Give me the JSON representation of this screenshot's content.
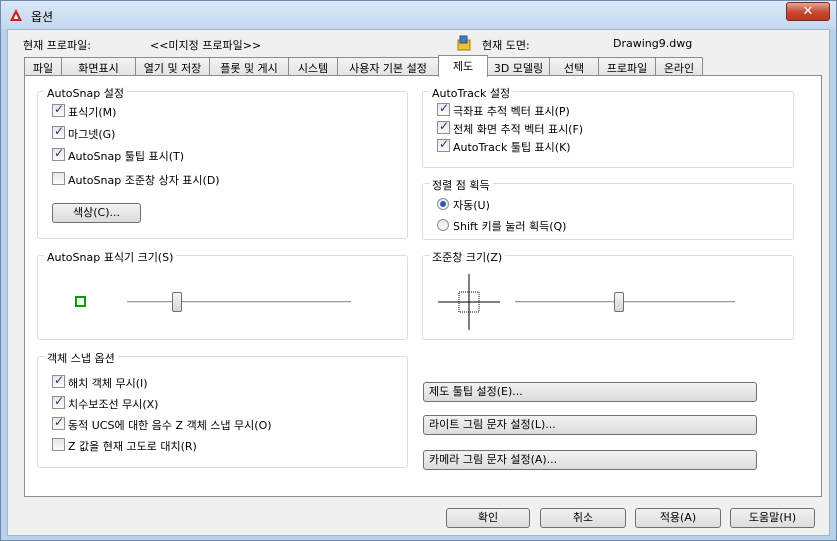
{
  "window": {
    "title": "옵션",
    "close_symbol": "✕"
  },
  "header": {
    "profile_label": "현재 프로파일:",
    "profile_value": "<<미지정 프로파일>>",
    "drawing_label": "현재 도면:",
    "drawing_value": "Drawing9.dwg"
  },
  "tabs": [
    {
      "label": "파일"
    },
    {
      "label": "화면표시"
    },
    {
      "label": "열기 및 저장"
    },
    {
      "label": "플롯 및 게시"
    },
    {
      "label": "시스템"
    },
    {
      "label": "사용자 기본 설정"
    },
    {
      "label": "제도"
    },
    {
      "label": "3D 모델링"
    },
    {
      "label": "선택"
    },
    {
      "label": "프로파일"
    },
    {
      "label": "온라인"
    }
  ],
  "active_tab": "제도",
  "autosnap": {
    "title": "AutoSnap 설정",
    "options": [
      {
        "label": "표식기(M)",
        "checked": true
      },
      {
        "label": "마그넷(G)",
        "checked": true
      },
      {
        "label": "AutoSnap 툴팁 표시(T)",
        "checked": true
      },
      {
        "label": "AutoSnap 조준창 상자 표시(D)",
        "checked": false
      }
    ],
    "color_button": "색상(C)..."
  },
  "autotrack": {
    "title": "AutoTrack 설정",
    "options": [
      {
        "label": "극좌표 추적 벡터 표시(P)",
        "checked": true
      },
      {
        "label": "전체 화면 추적 벡터 표시(F)",
        "checked": true
      },
      {
        "label": "AutoTrack 툴팁 표시(K)",
        "checked": true
      }
    ]
  },
  "alignment": {
    "title": "정렬 점 획득",
    "options": [
      {
        "label": "자동(U)",
        "selected": true
      },
      {
        "label": "Shift 키를 눌러 획득(Q)",
        "selected": false
      }
    ]
  },
  "marker_size": {
    "title": "AutoSnap 표식기 크기(S)",
    "slider_level": 0.22,
    "marker_color": "#0a9a0a"
  },
  "aperture_size": {
    "title": "조준창 크기(Z)",
    "slider_level": 0.47
  },
  "object_snap": {
    "title": "객체 스냅 옵션",
    "options": [
      {
        "label": "해치 객체 무시(I)",
        "checked": true
      },
      {
        "label": "치수보조선 무시(X)",
        "checked": true
      },
      {
        "label": "동적 UCS에 대한 음수 Z 객체 스냅 무시(O)",
        "checked": true
      },
      {
        "label": "Z 값을 현재 고도로 대치(R)",
        "checked": false
      }
    ]
  },
  "settings_buttons": [
    {
      "label": "제도 툴팁 설정(E)..."
    },
    {
      "label": "라이트 그림 문자 설정(L)..."
    },
    {
      "label": "카메라 그림 문자 설정(A)..."
    }
  ],
  "footer": {
    "ok": "확인",
    "cancel": "취소",
    "apply": "적용(A)",
    "help": "도움말(H)"
  }
}
